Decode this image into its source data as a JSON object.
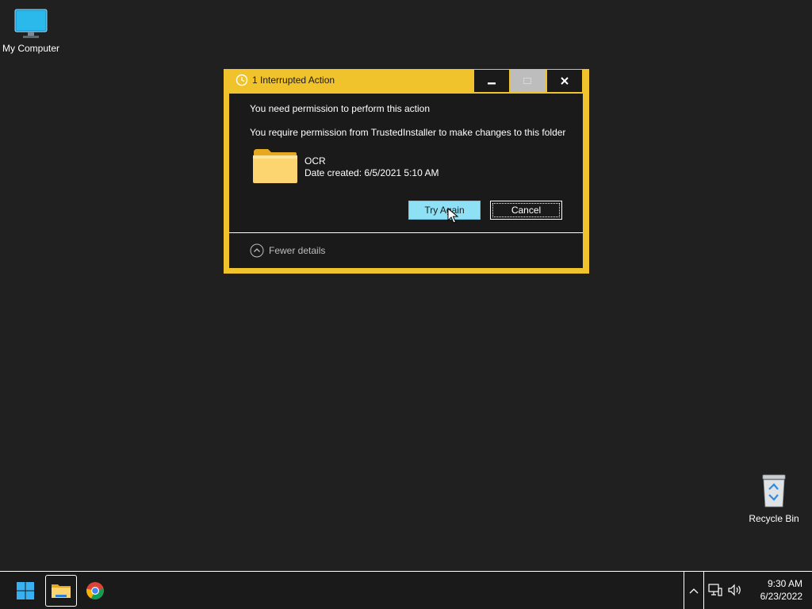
{
  "desktop": {
    "icons": [
      {
        "label": "My Computer"
      },
      {
        "label": "Recycle Bin"
      }
    ]
  },
  "dialog": {
    "title": "1 Interrupted Action",
    "message": "You need permission to perform this action",
    "detail": "You require permission from TrustedInstaller to make changes to this folder",
    "item": {
      "name": "OCR",
      "date_created": "Date created: 6/5/2021 5:10 AM"
    },
    "buttons": {
      "try_again": "Try Again",
      "cancel": "Cancel"
    },
    "fewer_details": "Fewer details"
  },
  "taskbar": {
    "apps": [
      "start-icon",
      "file-explorer-icon",
      "chrome-icon"
    ],
    "clock": {
      "time": "9:30 AM",
      "date": "6/23/2022"
    }
  },
  "colors": {
    "accent": "#f0c22b",
    "desktop_bg": "#202020",
    "dialog_bg": "#1a1a1a",
    "primary_button": "#8ee0f5"
  }
}
